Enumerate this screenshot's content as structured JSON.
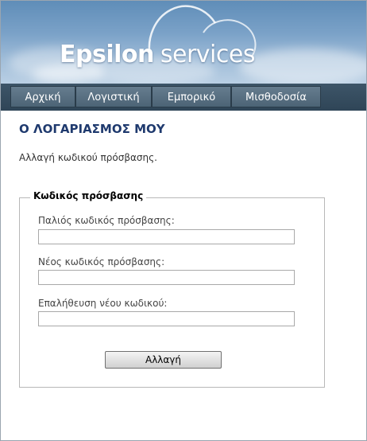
{
  "header": {
    "logo_bold": "Epsilon",
    "logo_light": "services"
  },
  "nav": {
    "items": [
      {
        "label": "Αρχική"
      },
      {
        "label": "Λογιστική"
      },
      {
        "label": "Εμπορικό"
      },
      {
        "label": "Μισθοδοσία"
      }
    ]
  },
  "main": {
    "title": "Ο ΛΟΓΑΡΙΑΣΜΟΣ ΜΟΥ",
    "subtitle": "Αλλαγή κωδικού πρόσβασης."
  },
  "form": {
    "legend": "Κωδικός πρόσβασης",
    "old_password_label": "Παλιός κωδικός πρόσβασης:",
    "old_password_value": "",
    "new_password_label": "Νέος κωδικός πρόσβασης:",
    "new_password_value": "",
    "confirm_password_label": "Επαλήθευση νέου κωδικού:",
    "confirm_password_value": "",
    "submit_label": "Αλλαγή"
  },
  "colors": {
    "title": "#1f3a6e",
    "nav_bar": "#2f4557",
    "banner_sky": "#7ba2c8"
  }
}
